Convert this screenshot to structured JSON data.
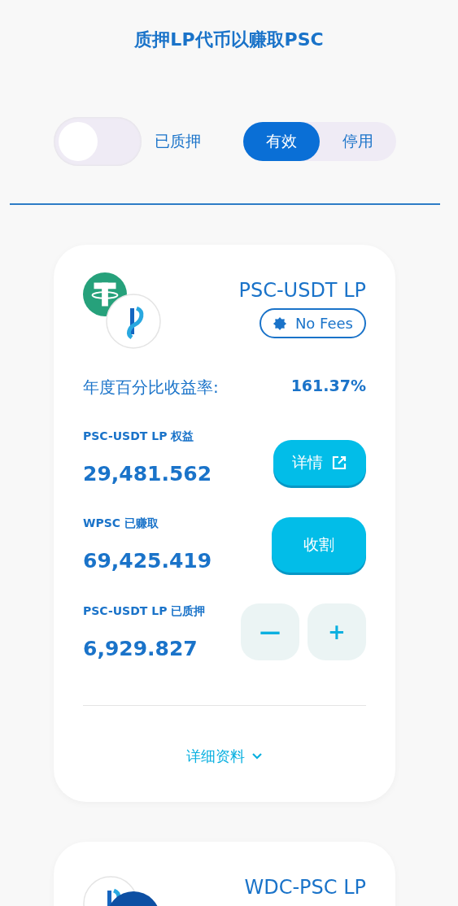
{
  "title": "质押LP代币以赚取PSC",
  "staked_only": {
    "label": "已质押",
    "on": false
  },
  "tabs": [
    {
      "label": "有效",
      "selected": true
    },
    {
      "label": "停用",
      "selected": false
    }
  ],
  "farms": [
    {
      "name": "PSC-USDT LP",
      "tokens": [
        {
          "kind": "tether"
        },
        {
          "kind": "psc"
        }
      ],
      "badge": "No Fees",
      "apr_label": "年度百分比收益率:",
      "apr": "161.37%",
      "equity_label": "PSC-USDT LP 权益",
      "equity": "29,481.562",
      "details_button": "详情",
      "earned_label": "WPSC 已赚取",
      "earned": "69,425.419",
      "harvest_button": "收割",
      "staked_label": "PSC-USDT LP 已质押",
      "staked": "6,929.827",
      "minus": "—",
      "plus": "+",
      "more": "详细资料"
    },
    {
      "name": "WDC-PSC LP",
      "tokens": [
        {
          "kind": "psc"
        },
        {
          "kind": "wdc"
        }
      ]
    }
  ]
}
